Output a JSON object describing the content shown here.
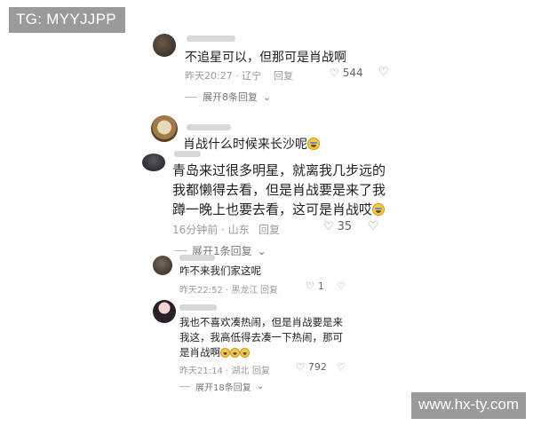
{
  "watermarks": {
    "top_left": "TG: MYYJJPP",
    "bottom_right": "www.hx-ty.com"
  },
  "comments": [
    {
      "text": "不追星可以，但那可是肖战啊",
      "time": "昨天20:27 · 辽宁",
      "reply_label": "回复",
      "likes": "544",
      "expand": "展开8条回复"
    },
    {
      "text": "肖战什么时候来长沙呢",
      "has_emoji": true
    },
    {
      "lines": [
        "青岛来过很多明星，就离我几步远的",
        "我都懒得去看，但是肖战要是来了我",
        "蹲一晚上也要去看，这可是肖战哎"
      ],
      "time": "16分钟前 · 山东",
      "reply_label": "回复",
      "likes": "35",
      "expand": "展开1条回复"
    },
    {
      "text": "咋不来我们家这呢",
      "time": "昨天22:52 · 黑龙江",
      "reply_label": "回复",
      "likes": "1"
    },
    {
      "lines": [
        "我也不喜欢凑热闹，但是肖战要是来",
        "我这，我高低得去凑一下热闹，那可",
        "是肖战啊"
      ],
      "time": "昨天21:14 · 湖北",
      "reply_label": "回复",
      "likes": "792",
      "expand": "展开18条回复"
    }
  ],
  "icons": {
    "like": "heart-outline-icon",
    "dislike": "broken-heart-icon",
    "expand": "chevron-down-icon",
    "emoji": "crying-face-emoji"
  }
}
